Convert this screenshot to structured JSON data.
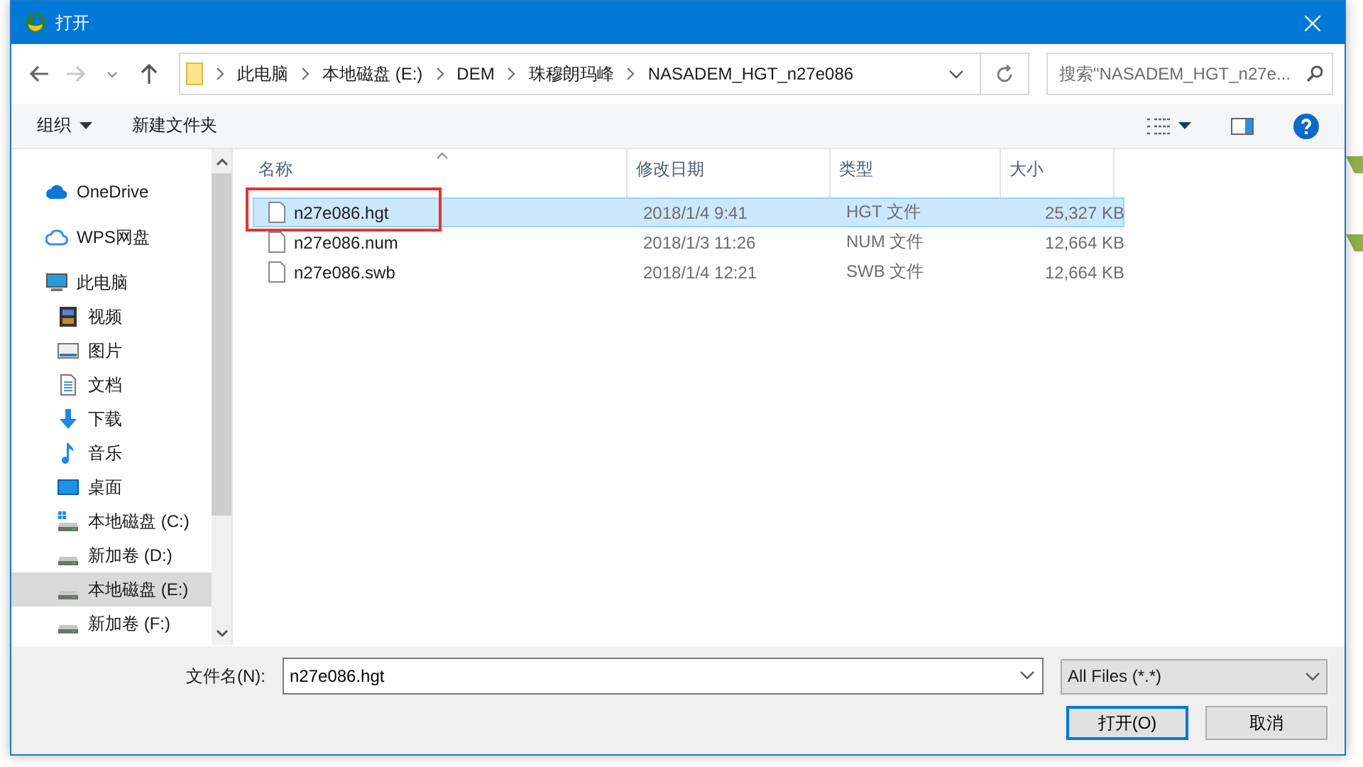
{
  "window": {
    "title": "打开"
  },
  "breadcrumb": [
    "此电脑",
    "本地磁盘 (E:)",
    "DEM",
    "珠穆朗玛峰",
    "NASADEM_HGT_n27e086"
  ],
  "search": {
    "placeholder": "搜索\"NASADEM_HGT_n27e..."
  },
  "toolbar": {
    "organize": "组织",
    "new_folder": "新建文件夹"
  },
  "sidebar": {
    "items": [
      {
        "label": "OneDrive",
        "kind": "cloud",
        "selected": false
      },
      {
        "label": "WPS网盘",
        "kind": "netdisk",
        "selected": false
      },
      {
        "label": "此电脑",
        "kind": "computer",
        "selected": false,
        "children": [
          {
            "label": "视频",
            "kind": "video",
            "selected": false
          },
          {
            "label": "图片",
            "kind": "pictures",
            "selected": false
          },
          {
            "label": "文档",
            "kind": "documents",
            "selected": false
          },
          {
            "label": "下载",
            "kind": "download",
            "selected": false
          },
          {
            "label": "音乐",
            "kind": "music",
            "selected": false
          },
          {
            "label": "桌面",
            "kind": "desktop",
            "selected": false
          },
          {
            "label": "本地磁盘 (C:)",
            "kind": "system-drive",
            "selected": false
          },
          {
            "label": "新加卷 (D:)",
            "kind": "drive",
            "selected": false
          },
          {
            "label": "本地磁盘 (E:)",
            "kind": "drive",
            "selected": true
          },
          {
            "label": "新加卷 (F:)",
            "kind": "drive",
            "selected": false
          }
        ]
      }
    ]
  },
  "table": {
    "columns": [
      "名称",
      "修改日期",
      "类型",
      "大小"
    ],
    "rows": [
      {
        "name": "n27e086.hgt",
        "date": "2018/1/4 9:41",
        "type": "HGT 文件",
        "size": "25,327 KB",
        "selected": true,
        "annotated": true
      },
      {
        "name": "n27e086.num",
        "date": "2018/1/3 11:26",
        "type": "NUM 文件",
        "size": "12,664 KB",
        "selected": false,
        "annotated": false
      },
      {
        "name": "n27e086.swb",
        "date": "2018/1/4 12:21",
        "type": "SWB 文件",
        "size": "12,664 KB",
        "selected": false,
        "annotated": false
      }
    ]
  },
  "file_name": {
    "label": "文件名(N):",
    "value": "n27e086.hgt"
  },
  "file_type": {
    "value": "All Files (*.*)"
  },
  "buttons": [
    {
      "label": "打开(O)",
      "default": true
    },
    {
      "label": "取消",
      "default": false
    }
  ]
}
